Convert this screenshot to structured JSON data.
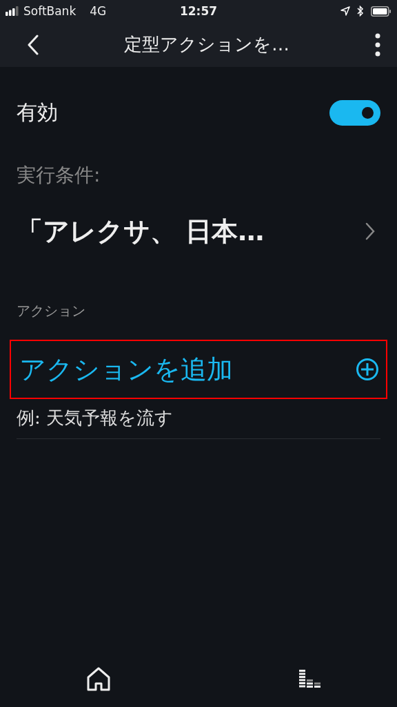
{
  "status_bar": {
    "carrier": "SoftBank",
    "network": "4G",
    "time": "12:57"
  },
  "header": {
    "title": "定型アクションを…"
  },
  "enabled": {
    "label": "有効",
    "on": true
  },
  "condition": {
    "label": "実行条件:",
    "value": "「アレクサ、 日本…"
  },
  "actions": {
    "heading": "アクション",
    "add_label": "アクションを追加",
    "highlighted": true,
    "example": "例: 天気予報を流す"
  },
  "bottom_nav": [
    {
      "kind": "home"
    },
    {
      "kind": "music"
    }
  ]
}
